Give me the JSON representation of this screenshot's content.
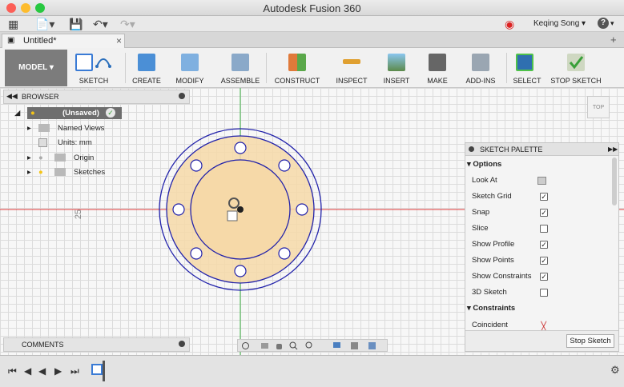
{
  "window": {
    "title": "Autodesk Fusion 360"
  },
  "quick_access": {
    "user_name": "Keqing Song",
    "help_label": "?"
  },
  "doc_tab": {
    "title": "Untitled*"
  },
  "toolbar": {
    "workspace": "MODEL",
    "groups": [
      {
        "label": "SKETCH"
      },
      {
        "label": "CREATE"
      },
      {
        "label": "MODIFY"
      },
      {
        "label": "ASSEMBLE"
      },
      {
        "label": "CONSTRUCT"
      },
      {
        "label": "INSPECT"
      },
      {
        "label": "INSERT"
      },
      {
        "label": "MAKE"
      },
      {
        "label": "ADD-INS"
      },
      {
        "label": "SELECT"
      },
      {
        "label": "STOP SKETCH"
      }
    ]
  },
  "viewcube": {
    "label": "TOP"
  },
  "browser": {
    "title": "BROWSER",
    "root": "(Unsaved)",
    "items": [
      {
        "label": "Named Views"
      },
      {
        "label": "Units: mm"
      },
      {
        "label": "Origin"
      },
      {
        "label": "Sketches"
      }
    ]
  },
  "dimension_label": "25",
  "palette": {
    "title": "SKETCH PALETTE",
    "options_header": "Options",
    "look_at": "Look At",
    "options": [
      {
        "label": "Sketch Grid",
        "checked": true
      },
      {
        "label": "Snap",
        "checked": true
      },
      {
        "label": "Slice",
        "checked": false
      },
      {
        "label": "Show Profile",
        "checked": true
      },
      {
        "label": "Show Points",
        "checked": true
      },
      {
        "label": "Show Constraints",
        "checked": true
      },
      {
        "label": "3D Sketch",
        "checked": false
      }
    ],
    "constraints_header": "Constraints",
    "constraint_first": "Coincident",
    "stop_button": "Stop Sketch"
  },
  "comments": {
    "title": "COMMENTS"
  },
  "colors": {
    "accent": "#2a6ebb",
    "sketch_line": "#2222aa",
    "profile_fill": "#f6d9a8",
    "axis_red": "#e23b3b",
    "axis_green": "#3cb043"
  }
}
